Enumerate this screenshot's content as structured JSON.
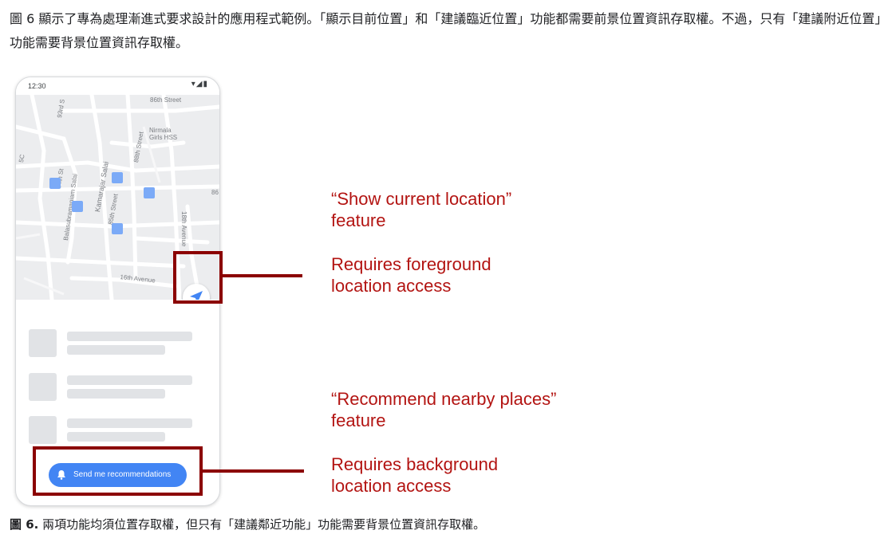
{
  "intro_text": "圖 6 顯示了專為處理漸進式要求設計的應用程式範例。「顯示目前位置」和「建議臨近位置」功能都需要前景位置資訊存取權。不過，只有「建議附近位置」功能需要背景位置資訊存取權。",
  "phone": {
    "status_time": "12:30",
    "status_icons": "▾◢▮",
    "map": {
      "streets": [
        "86th Street",
        "93rd S",
        "Nirmala Girls HSS",
        "88th Street",
        "Kamarajar Salai",
        "85th Street",
        "Balasubramaniam Salai",
        "18th Avenue",
        "16th Avenue",
        "86",
        "84th St",
        "5C"
      ]
    },
    "location_button_icon": "navigation-arrow-icon",
    "list_placeholder_count": 3,
    "recommend_button": {
      "icon": "bell-icon",
      "label": "Send me recommendations",
      "color": "#4285f4"
    }
  },
  "annotations": {
    "show_location_feature": "“Show current location”\nfeature",
    "foreground_access": "Requires foreground\nlocation access",
    "recommend_feature": "“Recommend nearby places”\nfeature",
    "background_access": "Requires background\nlocation access",
    "highlight_color": "#8b0000",
    "text_color": "#b31412"
  },
  "caption": {
    "label": "圖 6.",
    "text": " 兩項功能均須位置存取權，但只有「建議鄰近功能」功能需要背景位置資訊存取權。"
  }
}
